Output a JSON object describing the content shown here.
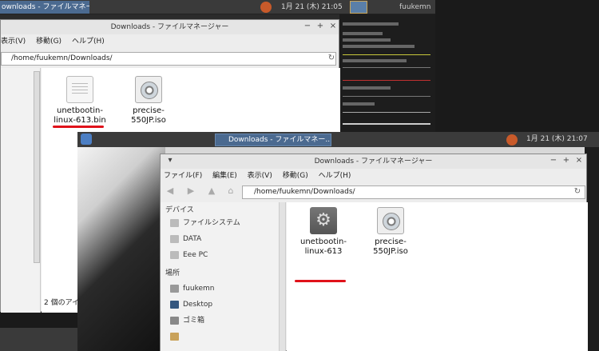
{
  "back": {
    "taskbar": {
      "task_label": "ownloads - ファイルマネー...",
      "clock": "1月 21 (木) 21:05",
      "user": "fuukemn"
    },
    "window": {
      "title": "Downloads - ファイルマネージャー",
      "menus": [
        "表示(V)",
        "移動(G)",
        "ヘルプ(H)"
      ],
      "path": "/home/fuukemn/Downloads/",
      "files": [
        {
          "name": "unetbootin-linux-613.bin",
          "icon": "binary-file-icon"
        },
        {
          "name": "precise-550JP.iso",
          "icon": "disc-image-icon"
        }
      ],
      "status": "2 個のアイ"
    }
  },
  "front": {
    "taskbar": {
      "task_label": "Downloads - ファイルマネー...",
      "clock": "1月 21 (木) 21:07"
    },
    "window": {
      "title": "Downloads - ファイルマネージャー",
      "menus": [
        "ファイル(F)",
        "編集(E)",
        "表示(V)",
        "移動(G)",
        "ヘルプ(H)"
      ],
      "path": "/home/fuukemn/Downloads/",
      "sidebar": {
        "devices_header": "デバイス",
        "devices": [
          "ファイルシステム",
          "DATA",
          "Eee PC"
        ],
        "places_header": "場所",
        "places": [
          "fuukemn",
          "Desktop",
          "ゴミ箱"
        ]
      },
      "files": [
        {
          "name": "unetbootin-linux-613",
          "icon": "executable-gear-icon"
        },
        {
          "name": "precise-550JP.iso",
          "icon": "disc-image-icon"
        }
      ]
    }
  },
  "colors": {
    "highlight_underline": "#e0121a",
    "task_active": "#4b6a90"
  }
}
